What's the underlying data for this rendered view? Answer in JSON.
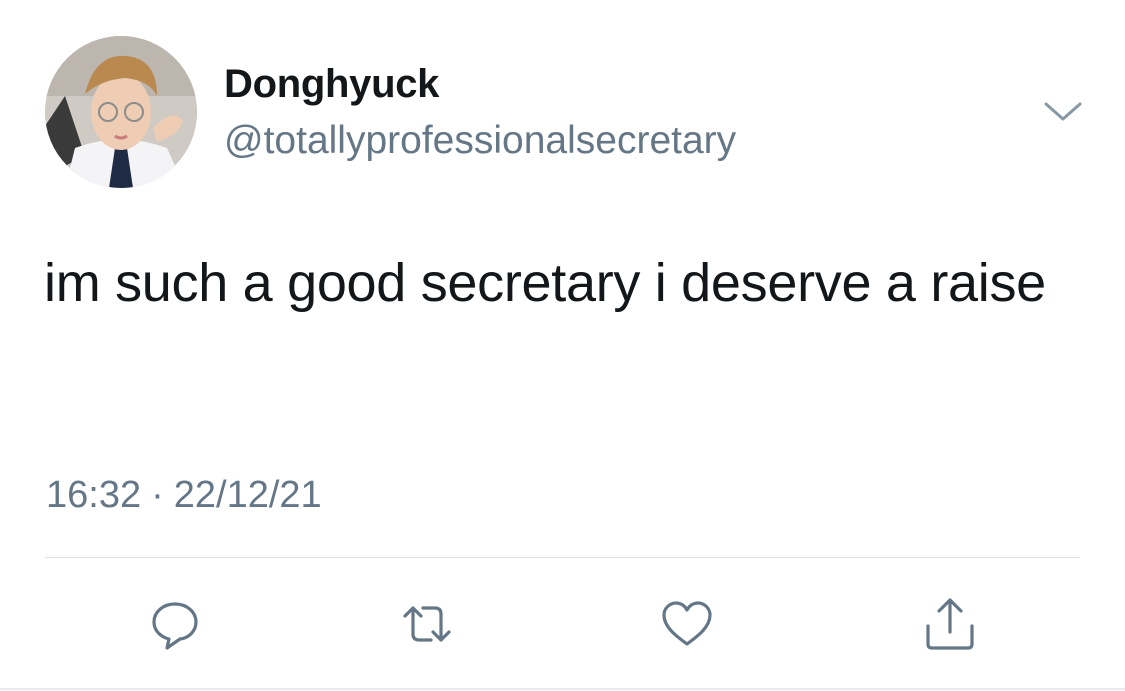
{
  "user": {
    "display_name": "Donghyuck",
    "handle": "@totallyprofessionalsecretary",
    "avatar": "avatar-photo"
  },
  "tweet": {
    "text": "im such a good secretary i deserve a raise",
    "time": "16:32",
    "separator": "·",
    "date": "22/12/21"
  },
  "actions": {
    "reply_icon": "reply-icon",
    "retweet_icon": "retweet-icon",
    "like_icon": "heart-icon",
    "share_icon": "share-icon",
    "more_icon": "chevron-down-icon"
  },
  "colors": {
    "text": "#14171a",
    "secondary": "#657786",
    "divider": "#dbe1e6"
  }
}
